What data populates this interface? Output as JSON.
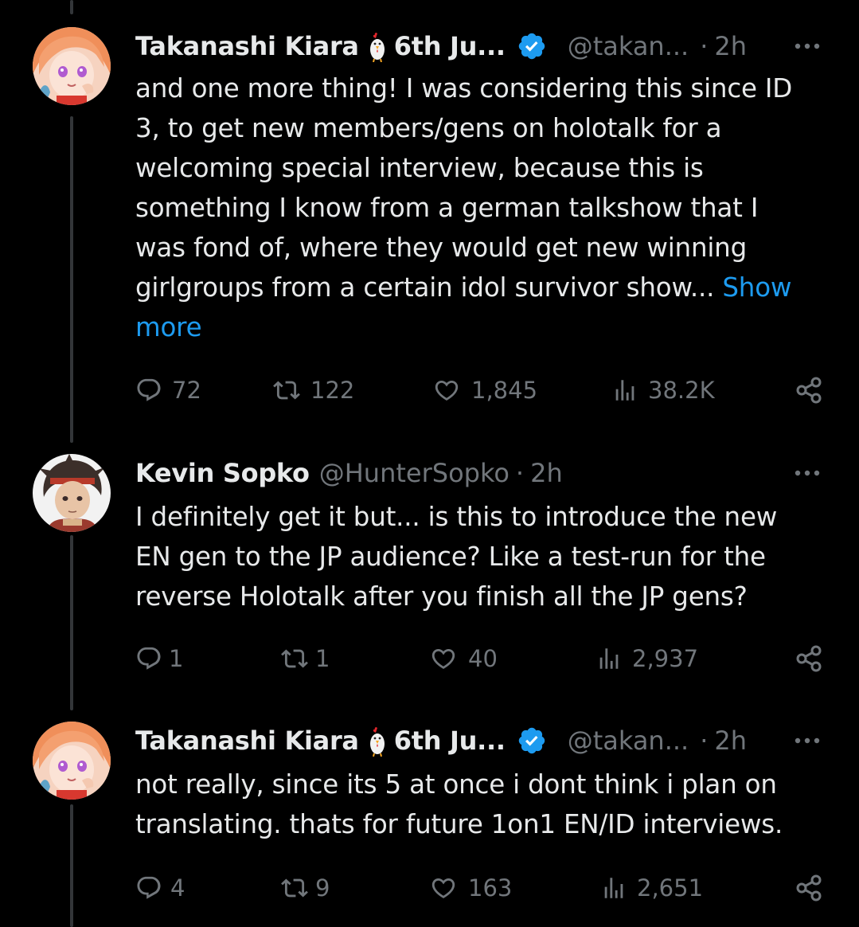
{
  "colors": {
    "background": "#000000",
    "text": "#e7e9ea",
    "muted": "#71767b",
    "link": "#1d9bf0",
    "verified": "#1d9bf0"
  },
  "tweets": [
    {
      "name": "Takanashi Kiara",
      "name_suffix": "6th Ju...",
      "verified": true,
      "handle": "@takan...",
      "time": "2h",
      "text_lines": [
        "and one more thing! I was considering this since ID",
        "3, to get new members/gens on holotalk for a",
        "welcoming special interview, because this is",
        "something I know from a german talkshow that I",
        "was fond of, where they would get new winning",
        "girlgroups from a certain idol survivor show... "
      ],
      "show_more_a": "Show",
      "show_more_b": "more",
      "replies": "72",
      "retweets": "122",
      "likes": "1,845",
      "views": "38.2K"
    },
    {
      "name": "Kevin Sopko",
      "handle": "@HunterSopko",
      "time": "2h",
      "text_lines": [
        "I definitely get it but... is this to introduce the new",
        "EN gen to the JP audience? Like a test-run for the",
        "reverse Holotalk after you finish all the JP gens?"
      ],
      "replies": "1",
      "retweets": "1",
      "likes": "40",
      "views": "2,937"
    },
    {
      "name": "Takanashi Kiara",
      "name_suffix": "6th Ju...",
      "verified": true,
      "handle": "@takan...",
      "time": "2h",
      "text_lines": [
        "not really, since its 5 at once i dont think i plan on",
        "translating. thats for future 1on1 EN/ID interviews."
      ],
      "replies": "4",
      "retweets": "9",
      "likes": "163",
      "views": "2,651"
    }
  ]
}
